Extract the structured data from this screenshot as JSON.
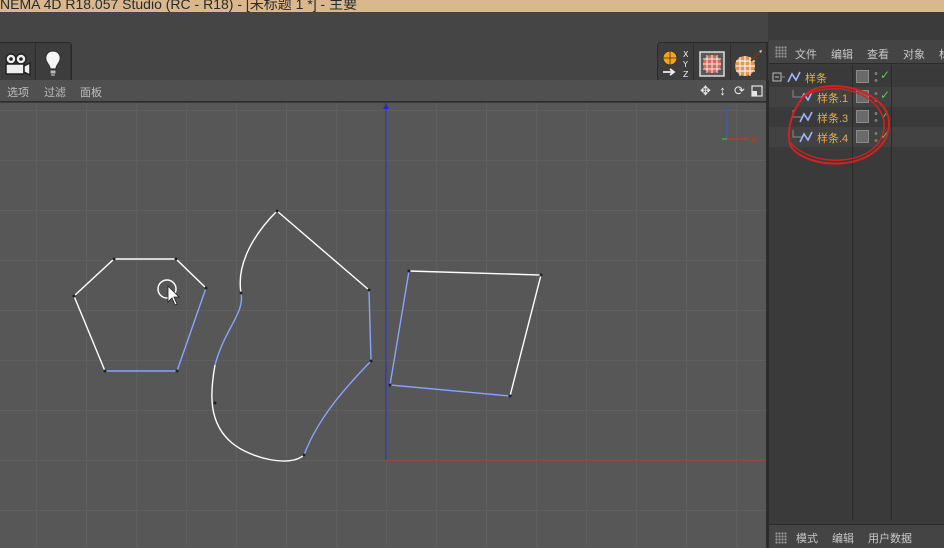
{
  "window": {
    "title": "NEMA 4D R18.057 Studio (RC - R18) - [未标题 1 *] - 主要"
  },
  "toolbar": {
    "left_icons": [
      "camera-icon",
      "light-icon"
    ],
    "right_icons": [
      "coordinate-system-icon",
      "render-region-icon",
      "render-settings-icon"
    ],
    "xyz_labels": [
      "X",
      "Y",
      "Z"
    ]
  },
  "viewport_menu": {
    "items": [
      "选项",
      "过滤",
      "面板"
    ],
    "nav_icons": [
      "move-icon",
      "zoom-icon",
      "rotate-icon",
      "layout-icon"
    ]
  },
  "viewport": {
    "axis_labels": {
      "y": "Y",
      "x": "X"
    },
    "colors": {
      "spline_selected": "#8aa2ff",
      "spline_default": "#ffffff",
      "x_axis": "#c23a2a",
      "y_axis": "#2a2acc",
      "background": "#575757"
    }
  },
  "object_manager": {
    "menu": [
      "文件",
      "编辑",
      "查看",
      "对象",
      "标"
    ],
    "objects": [
      {
        "label": "样条",
        "level": 0
      },
      {
        "label": "样条.1",
        "level": 1
      },
      {
        "label": "样条.3",
        "level": 1
      },
      {
        "label": "样条.4",
        "level": 1
      }
    ]
  },
  "attribute_manager": {
    "menu": [
      "模式",
      "编辑",
      "用户数据"
    ]
  },
  "colors": {
    "label_orange": "#e6b23a",
    "check_green": "#48d048",
    "annotation_red": "#d42020"
  }
}
